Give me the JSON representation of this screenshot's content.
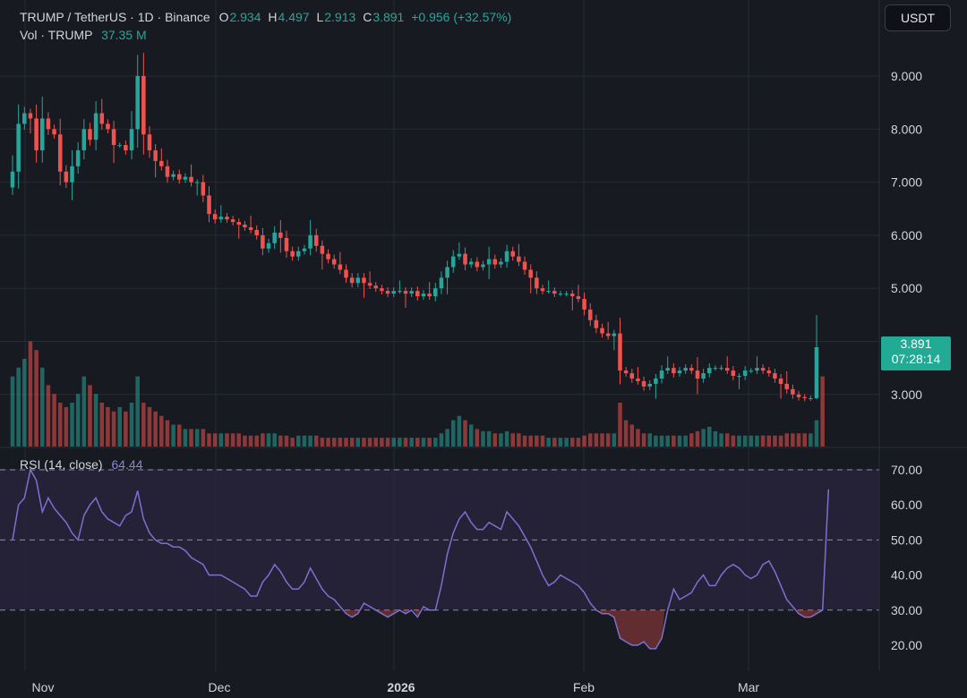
{
  "legend": {
    "symbol": "TRUMP / TetherUS · 1D · Binance",
    "o_label": "O",
    "o": "2.934",
    "h_label": "H",
    "h": "4.497",
    "l_label": "L",
    "l": "2.913",
    "c_label": "C",
    "c": "3.891",
    "change": "+0.956 (+32.57%)",
    "vol_label": "Vol · TRUMP",
    "vol": "37.35 M",
    "rsi_label": "RSI (14, close)",
    "rsi": "64.44"
  },
  "toolbar": {
    "currency_button": "USDT"
  },
  "last_price": {
    "price": "3.891",
    "countdown": "07:28:14"
  },
  "colors": {
    "up": "#26a69a",
    "down": "#ef5350",
    "rsi_line": "#7e6fcf",
    "rsi_band": "#2b2540",
    "background": "#171a21",
    "grid": "#262a33"
  },
  "chart_data": [
    {
      "type": "candlestick",
      "title": "TRUMP / TetherUS · 1D · Binance",
      "x_ticks": [
        "Nov",
        "Dec",
        "2026",
        "Feb",
        "Mar"
      ],
      "y_ticks": [
        "9.000",
        "8.000",
        "7.000",
        "6.000",
        "5.000",
        "4.000",
        "3.000"
      ],
      "ylim": [
        2.0,
        9.8
      ],
      "grid": true,
      "closes": [
        7.2,
        8.1,
        8.3,
        8.2,
        7.6,
        8.2,
        8.0,
        7.9,
        7.2,
        7.0,
        7.3,
        7.6,
        8.0,
        7.8,
        8.3,
        8.1,
        8.0,
        7.7,
        7.7,
        7.6,
        8.0,
        9.0,
        7.9,
        7.6,
        7.4,
        7.3,
        7.1,
        7.15,
        7.05,
        7.1,
        7.0,
        7.0,
        6.75,
        6.4,
        6.3,
        6.35,
        6.3,
        6.25,
        6.2,
        6.15,
        6.1,
        6.0,
        5.75,
        5.85,
        6.05,
        5.95,
        5.7,
        5.6,
        5.7,
        5.75,
        6.0,
        5.8,
        5.65,
        5.55,
        5.45,
        5.35,
        5.2,
        5.1,
        5.2,
        5.1,
        5.05,
        5.0,
        4.95,
        4.9,
        4.95,
        4.95,
        4.9,
        4.95,
        4.85,
        4.9,
        4.85,
        5.0,
        5.2,
        5.4,
        5.6,
        5.65,
        5.45,
        5.5,
        5.4,
        5.45,
        5.55,
        5.45,
        5.5,
        5.7,
        5.6,
        5.5,
        5.35,
        5.2,
        5.0,
        4.95,
        4.95,
        4.9,
        4.9,
        4.9,
        4.85,
        4.8,
        4.6,
        4.4,
        4.25,
        4.15,
        4.1,
        4.15,
        3.45,
        3.4,
        3.3,
        3.25,
        3.15,
        3.2,
        3.3,
        3.45,
        3.5,
        3.4,
        3.45,
        3.5,
        3.45,
        3.3,
        3.4,
        3.5,
        3.5,
        3.5,
        3.45,
        3.35,
        3.35,
        3.45,
        3.45,
        3.5,
        3.45,
        3.4,
        3.3,
        3.2,
        3.1,
        3.0,
        2.95,
        2.93,
        2.93,
        3.891
      ],
      "volume_ticks_unit": "TRUMP",
      "volumes": [
        16,
        18,
        20,
        24,
        22,
        18,
        14,
        12,
        10,
        9,
        10,
        12,
        16,
        14,
        12,
        10,
        9,
        8,
        9,
        8,
        10,
        16,
        10,
        9,
        8,
        7,
        6,
        5,
        5,
        4,
        4,
        4,
        4,
        3,
        3,
        3,
        3,
        3,
        3,
        2.5,
        2.5,
        2.5,
        3,
        3,
        3,
        2.5,
        2.5,
        2,
        2.5,
        2.5,
        2.5,
        2.5,
        2,
        2,
        2,
        2,
        2,
        2,
        2,
        2,
        2,
        2,
        2,
        2,
        2,
        2,
        2,
        2,
        2,
        2,
        2,
        2,
        3,
        4,
        6,
        7,
        6,
        5,
        4,
        3.5,
        3.5,
        3,
        3,
        3.5,
        3,
        3,
        2.5,
        2.5,
        2.5,
        2.5,
        2,
        2,
        2,
        2,
        2,
        2,
        2.5,
        3,
        3,
        3,
        3,
        3,
        10,
        6,
        5,
        4,
        3,
        3,
        2.5,
        2.5,
        2.5,
        2.5,
        2.5,
        2.5,
        3,
        3.5,
        4,
        4.5,
        3.5,
        3,
        3,
        2.5,
        2.5,
        2.5,
        2.5,
        2.5,
        2.5,
        2.5,
        2.5,
        2.5,
        3,
        3,
        3,
        3,
        3,
        6,
        16
      ]
    },
    {
      "type": "line",
      "title": "RSI (14, close)",
      "y_ticks": [
        "70.00",
        "60.00",
        "50.00",
        "40.00",
        "30.00",
        "20.00"
      ],
      "ylim": [
        15,
        72
      ],
      "bands": [
        30,
        50,
        70
      ],
      "values": [
        50,
        60,
        62,
        70,
        67,
        58,
        62,
        59,
        57,
        55,
        52,
        50,
        57,
        60,
        62,
        58,
        56,
        55,
        54,
        57,
        58,
        64,
        56,
        52,
        50,
        49,
        49,
        48,
        48,
        47,
        45,
        44,
        43,
        40,
        40,
        40,
        39,
        38,
        37,
        36,
        34,
        34,
        38,
        40,
        43,
        41,
        38,
        36,
        36,
        38,
        42,
        39,
        36,
        34,
        33,
        31,
        29,
        28,
        29,
        32,
        31,
        30,
        29,
        28,
        29,
        30,
        29,
        30,
        28,
        31,
        30,
        30,
        37,
        46,
        52,
        56,
        58,
        55,
        53,
        53,
        55,
        54,
        53,
        58,
        56,
        54,
        51,
        48,
        44,
        40,
        37,
        38,
        40,
        39,
        38,
        37,
        35,
        32,
        30,
        29,
        29,
        28,
        22,
        21,
        20,
        20,
        21,
        19,
        19,
        22,
        30,
        36,
        33,
        34,
        35,
        38,
        40,
        37,
        37,
        40,
        42,
        43,
        42,
        40,
        39,
        40,
        43,
        44,
        41,
        37,
        33,
        31,
        29,
        28,
        28,
        29,
        30,
        64.44
      ]
    }
  ]
}
